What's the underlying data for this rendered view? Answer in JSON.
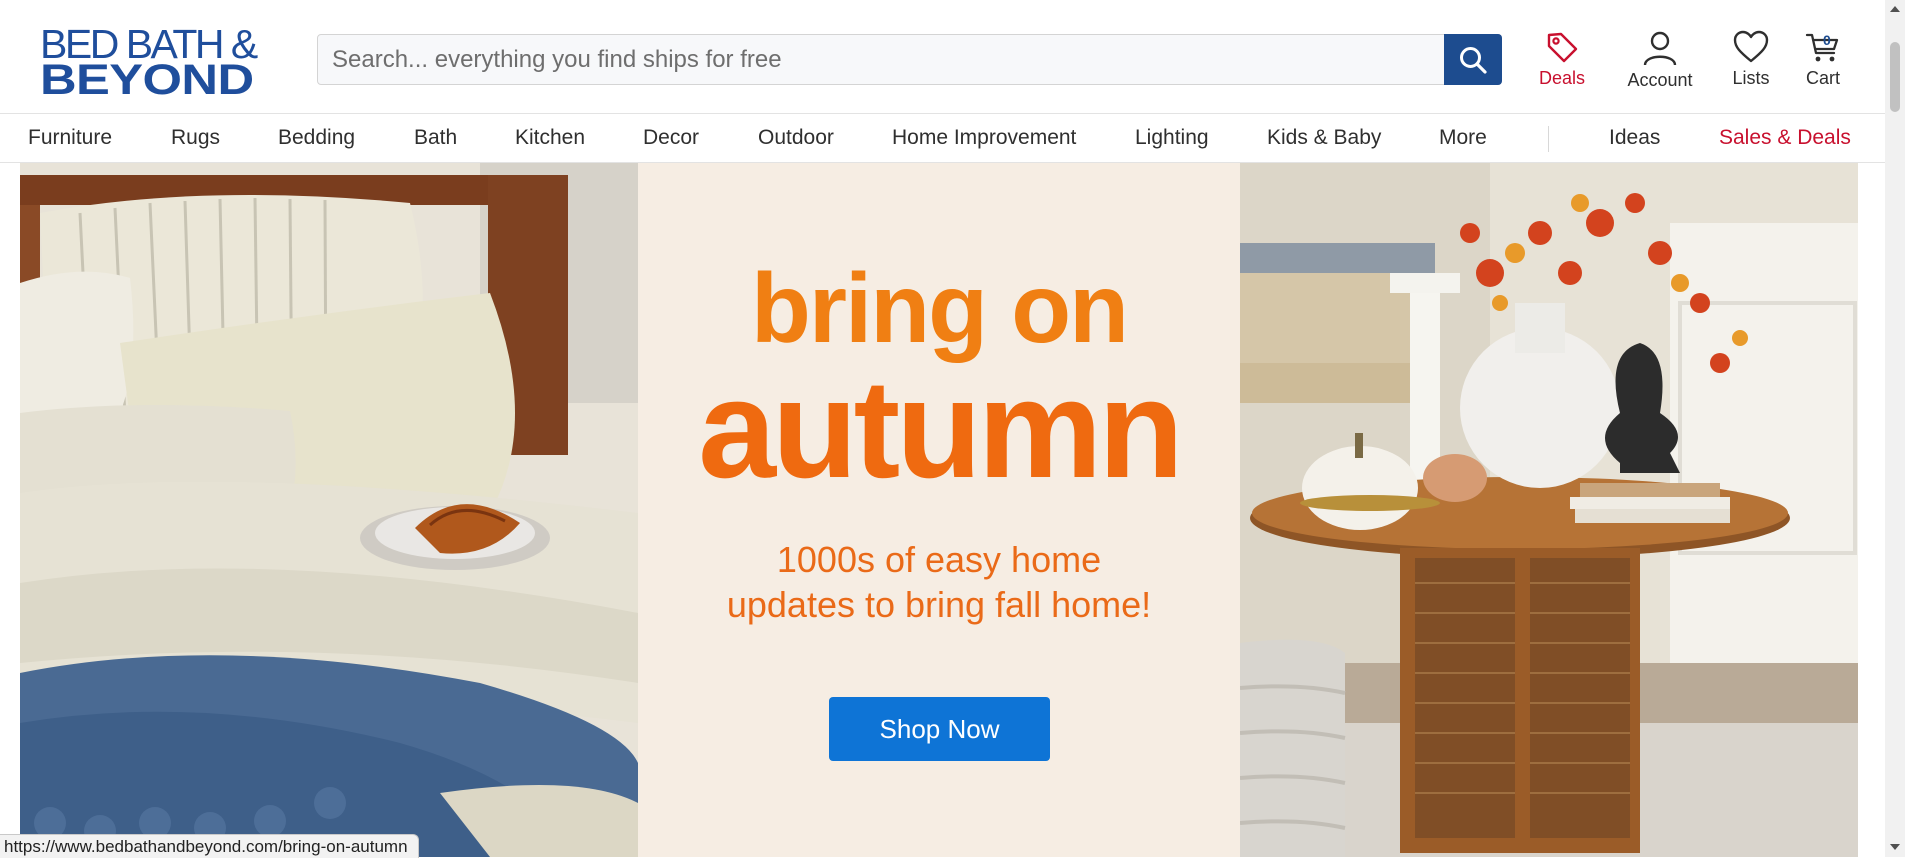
{
  "brand": {
    "logo_line1": "BED BATH &",
    "logo_line2": "BEYOND",
    "color": "#1f4e9c"
  },
  "search": {
    "placeholder": "Search... everything you find ships for free",
    "icon": "search-icon"
  },
  "header_links": {
    "deals": "Deals",
    "account": "Account",
    "lists": "Lists",
    "cart": "Cart",
    "cart_count": "0"
  },
  "nav": {
    "items": [
      "Furniture",
      "Rugs",
      "Bedding",
      "Bath",
      "Kitchen",
      "Decor",
      "Outdoor",
      "Home Improvement",
      "Lighting",
      "Kids & Baby",
      "More"
    ],
    "ideas": "Ideas",
    "sales": "Sales & Deals"
  },
  "hero": {
    "line1": "bring on",
    "line2": "autumn",
    "sub1": "1000s of easy home",
    "sub2": "updates to bring fall home!",
    "cta": "Shop Now",
    "colors": {
      "orange": "#ef6a10",
      "button": "#0e74d6",
      "background": "#f6ede3"
    }
  },
  "status_url": "https://www.bedbathandbeyond.com/bring-on-autumn"
}
